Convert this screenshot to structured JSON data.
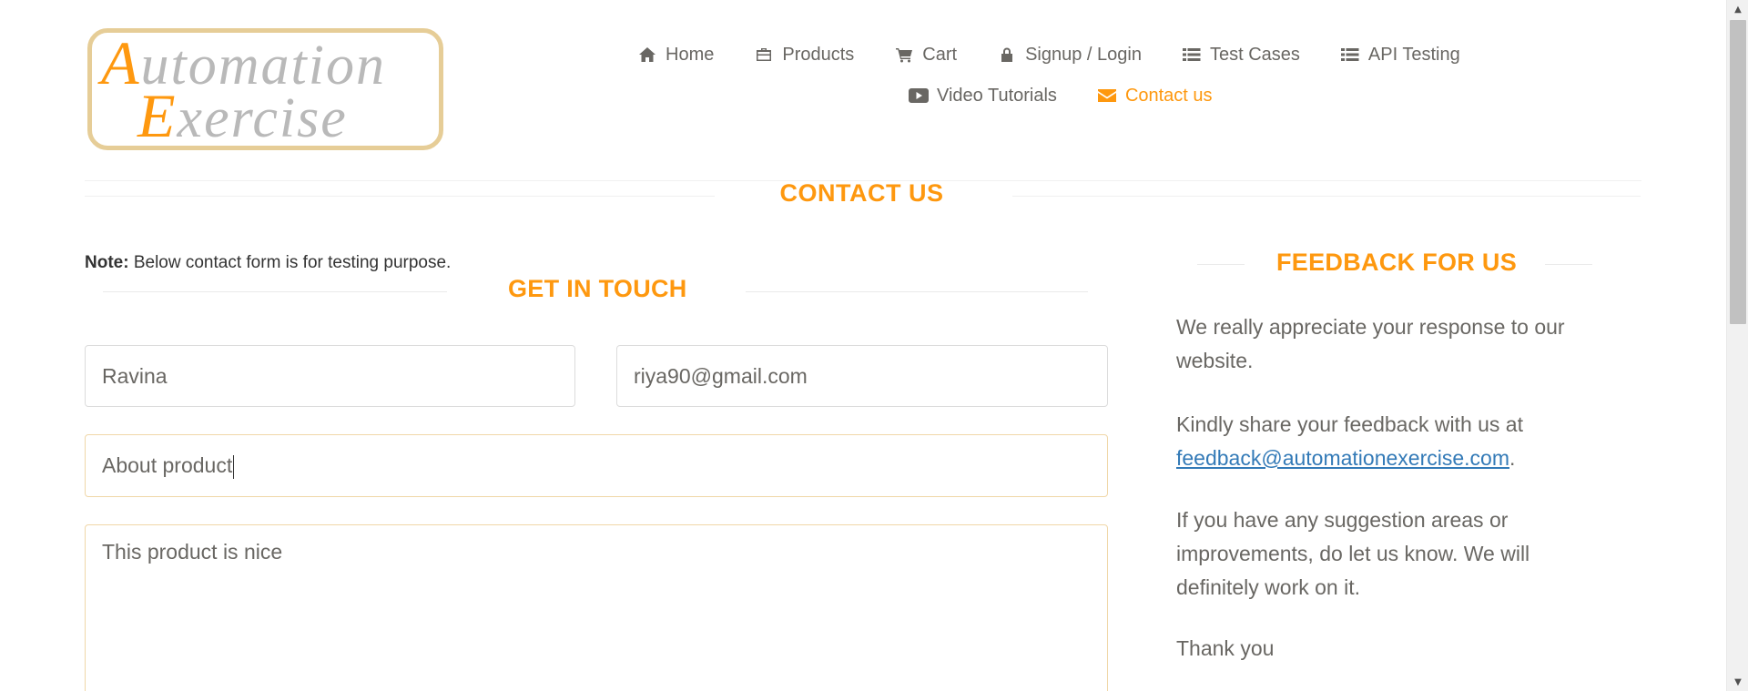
{
  "logo": {
    "line1_initial": "A",
    "line1_rest": "utomation",
    "line2_initial": "E",
    "line2_rest": "xercise"
  },
  "nav": {
    "items": [
      {
        "label": "Home",
        "icon": "home-icon"
      },
      {
        "label": "Products",
        "icon": "briefcase-icon"
      },
      {
        "label": "Cart",
        "icon": "cart-icon"
      },
      {
        "label": "Signup / Login",
        "icon": "lock-icon"
      },
      {
        "label": "Test Cases",
        "icon": "list-icon"
      },
      {
        "label": "API Testing",
        "icon": "list-icon"
      },
      {
        "label": "Video Tutorials",
        "icon": "youtube-play-icon"
      },
      {
        "label": "Contact us",
        "icon": "envelope-icon",
        "active": true
      }
    ]
  },
  "page": {
    "title": "CONTACT US",
    "note_label": "Note:",
    "note_text": " Below contact form is for testing purpose."
  },
  "form": {
    "title": "GET IN TOUCH",
    "name_value": "Ravina",
    "email_value": "riya90@gmail.com",
    "subject_value": "About product",
    "message_value": "This product is nice"
  },
  "feedback": {
    "title": "FEEDBACK FOR US",
    "p1": "We really appreciate your response to our website.",
    "p2_text": "Kindly share your feedback with us at ",
    "p2_link": "feedback@automationexercise.com",
    "p2_end": ".",
    "p3": "If you have any suggestion areas or improvements, do let us know. We will definitely work on it.",
    "p4": "Thank you"
  },
  "colors": {
    "accent": "#fe980f",
    "text": "#696763",
    "link": "#337ab7"
  }
}
